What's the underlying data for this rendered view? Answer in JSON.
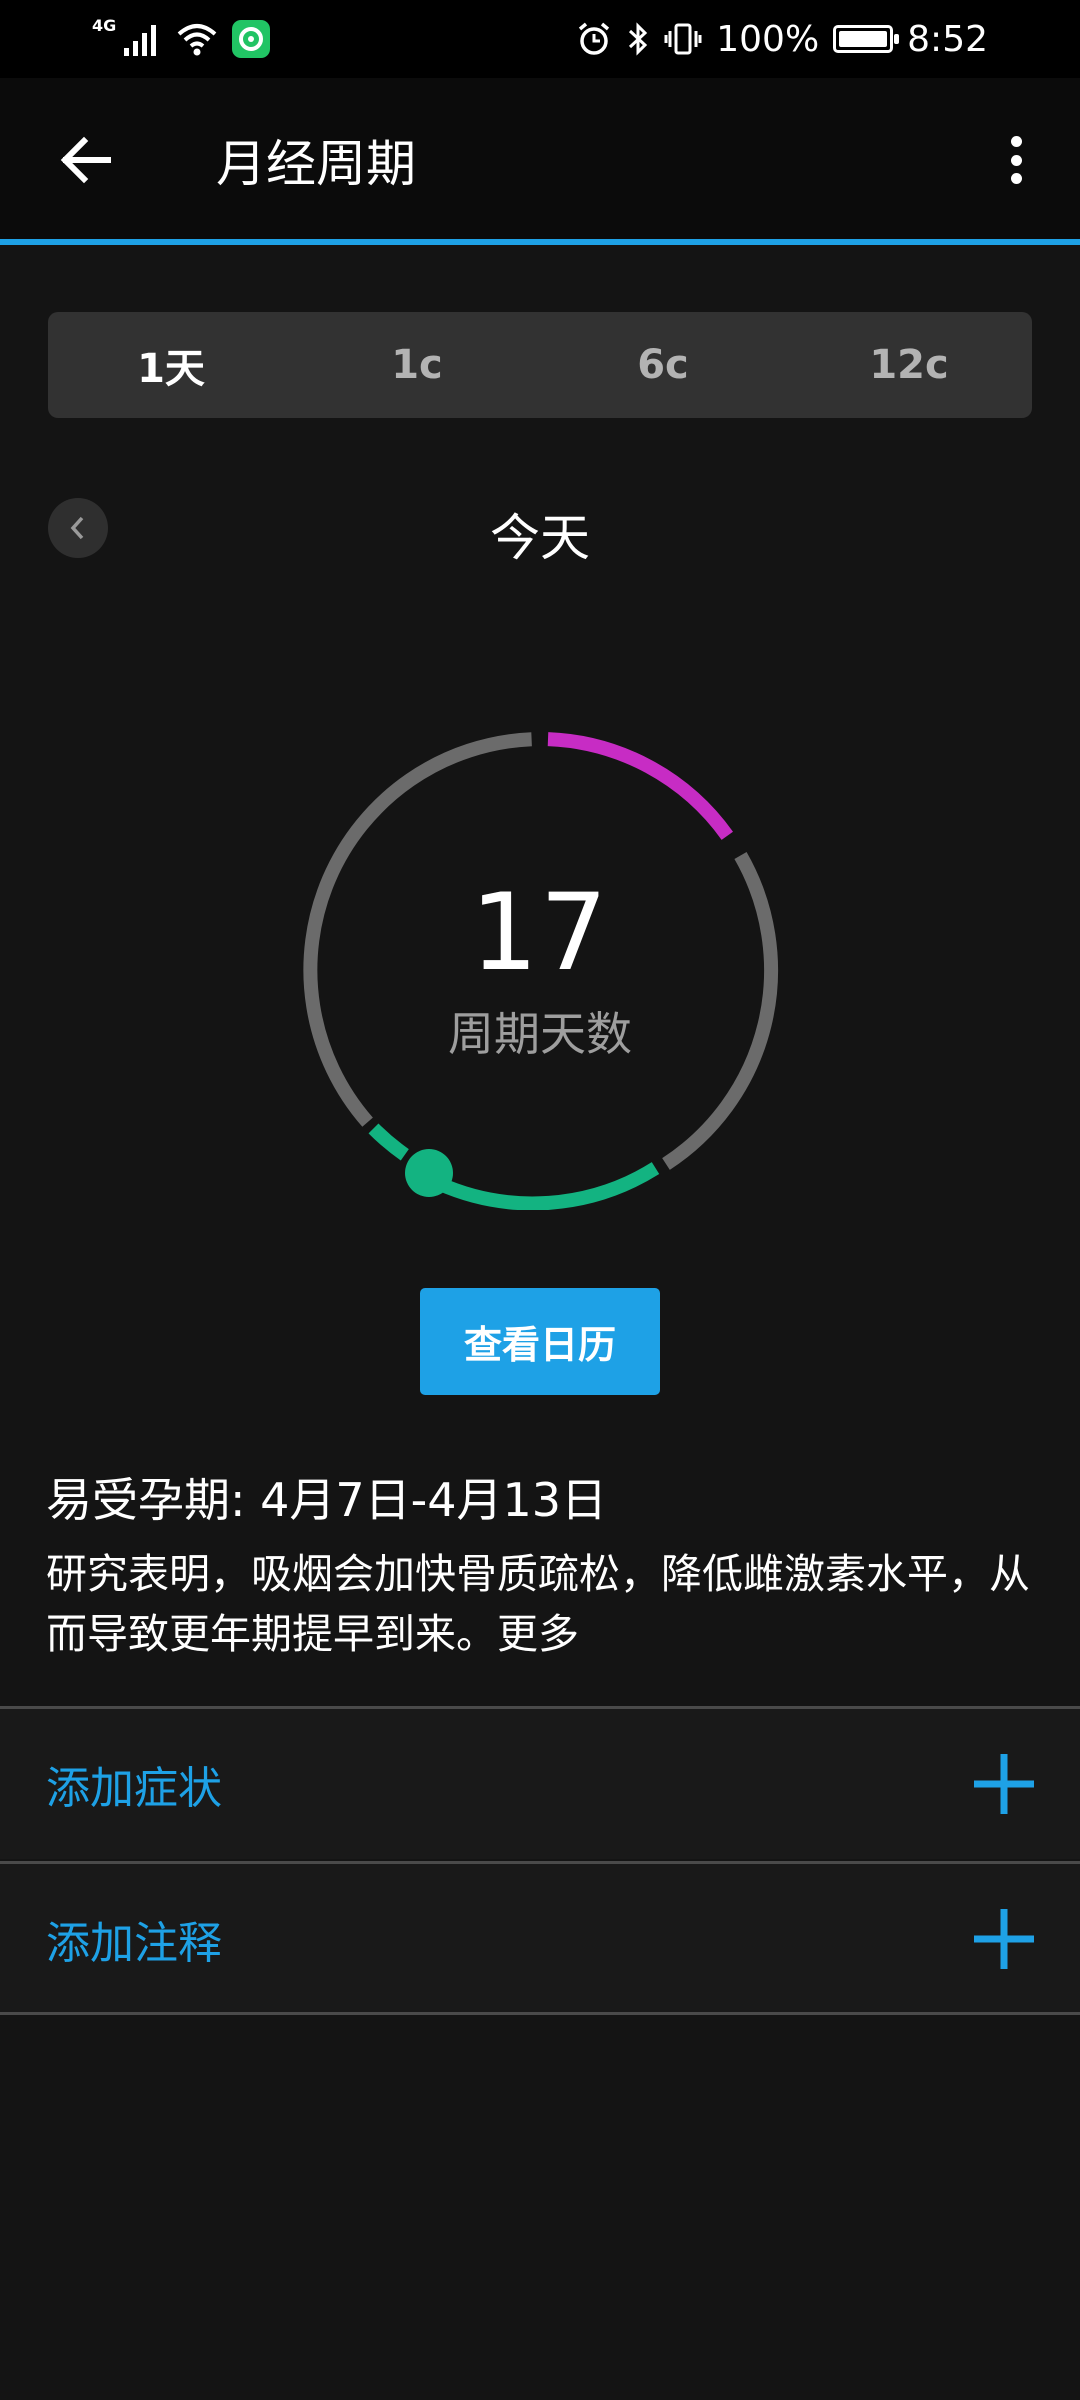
{
  "status_bar": {
    "network": "4G",
    "battery_text": "100%",
    "time": "8:52"
  },
  "app_bar": {
    "title": "月经周期"
  },
  "tabs": [
    {
      "label": "1天",
      "active": true
    },
    {
      "label": "1c",
      "active": false
    },
    {
      "label": "6c",
      "active": false
    },
    {
      "label": "12c",
      "active": false
    }
  ],
  "date_nav": {
    "title": "今天"
  },
  "cycle": {
    "day_number": "17",
    "day_label": "周期天数"
  },
  "calendar_button": "查看日历",
  "fertile_window": "易受孕期: 4月7日-4月13日",
  "tip": {
    "text": "研究表明，吸烟会加快骨质疏松，降低雌激素水平，从而导致更年期提早到来。",
    "more": "更多"
  },
  "actions": {
    "add_symptom": "添加症状",
    "add_note": "添加注释"
  },
  "colors": {
    "accent": "#1ea1e6",
    "period": "#c72cc4",
    "fertile": "#13b381",
    "ring_base": "#6b6b6b"
  }
}
